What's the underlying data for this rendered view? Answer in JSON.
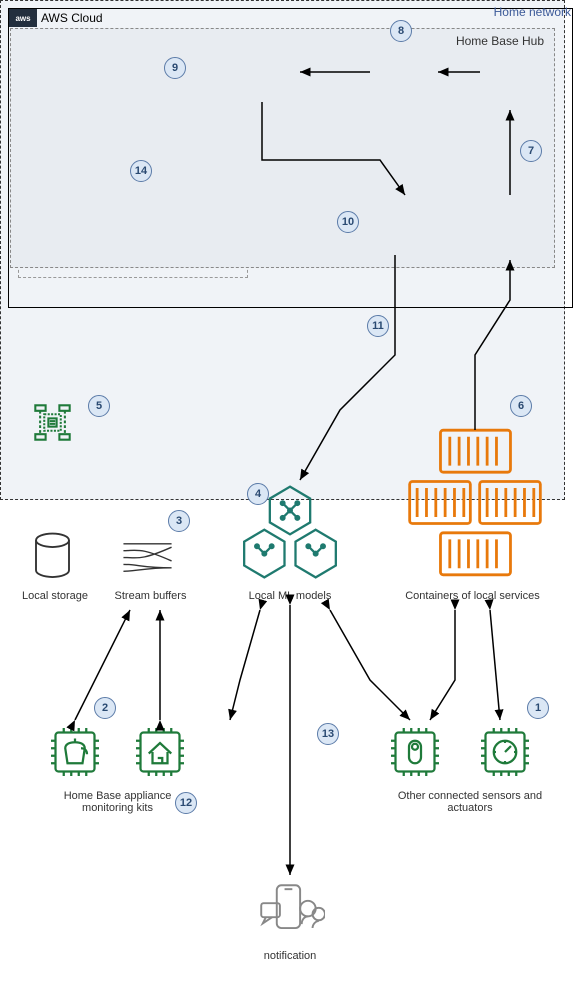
{
  "aws_cloud": {
    "title": "AWS Cloud",
    "logo": "aws"
  },
  "badges": {
    "b1": "1",
    "b2": "2",
    "b3": "3",
    "b4": "4",
    "b5": "5",
    "b6": "6",
    "b7": "7",
    "b8": "8",
    "b9": "9",
    "b10": "10",
    "b11": "11",
    "b12": "12",
    "b13": "13",
    "b14": "14"
  },
  "home_network": {
    "title": "Home network"
  },
  "hub": {
    "title": "Home Base Hub"
  },
  "labels": {
    "local_storage": "Local storage",
    "stream_buffers": "Stream buffers",
    "local_ml": "Local ML models",
    "containers": "Containers of local services",
    "appliance_kits": "Home Base appliance monitoring kits",
    "sensors": "Other connected sensors and actuators",
    "notification": "notification"
  }
}
